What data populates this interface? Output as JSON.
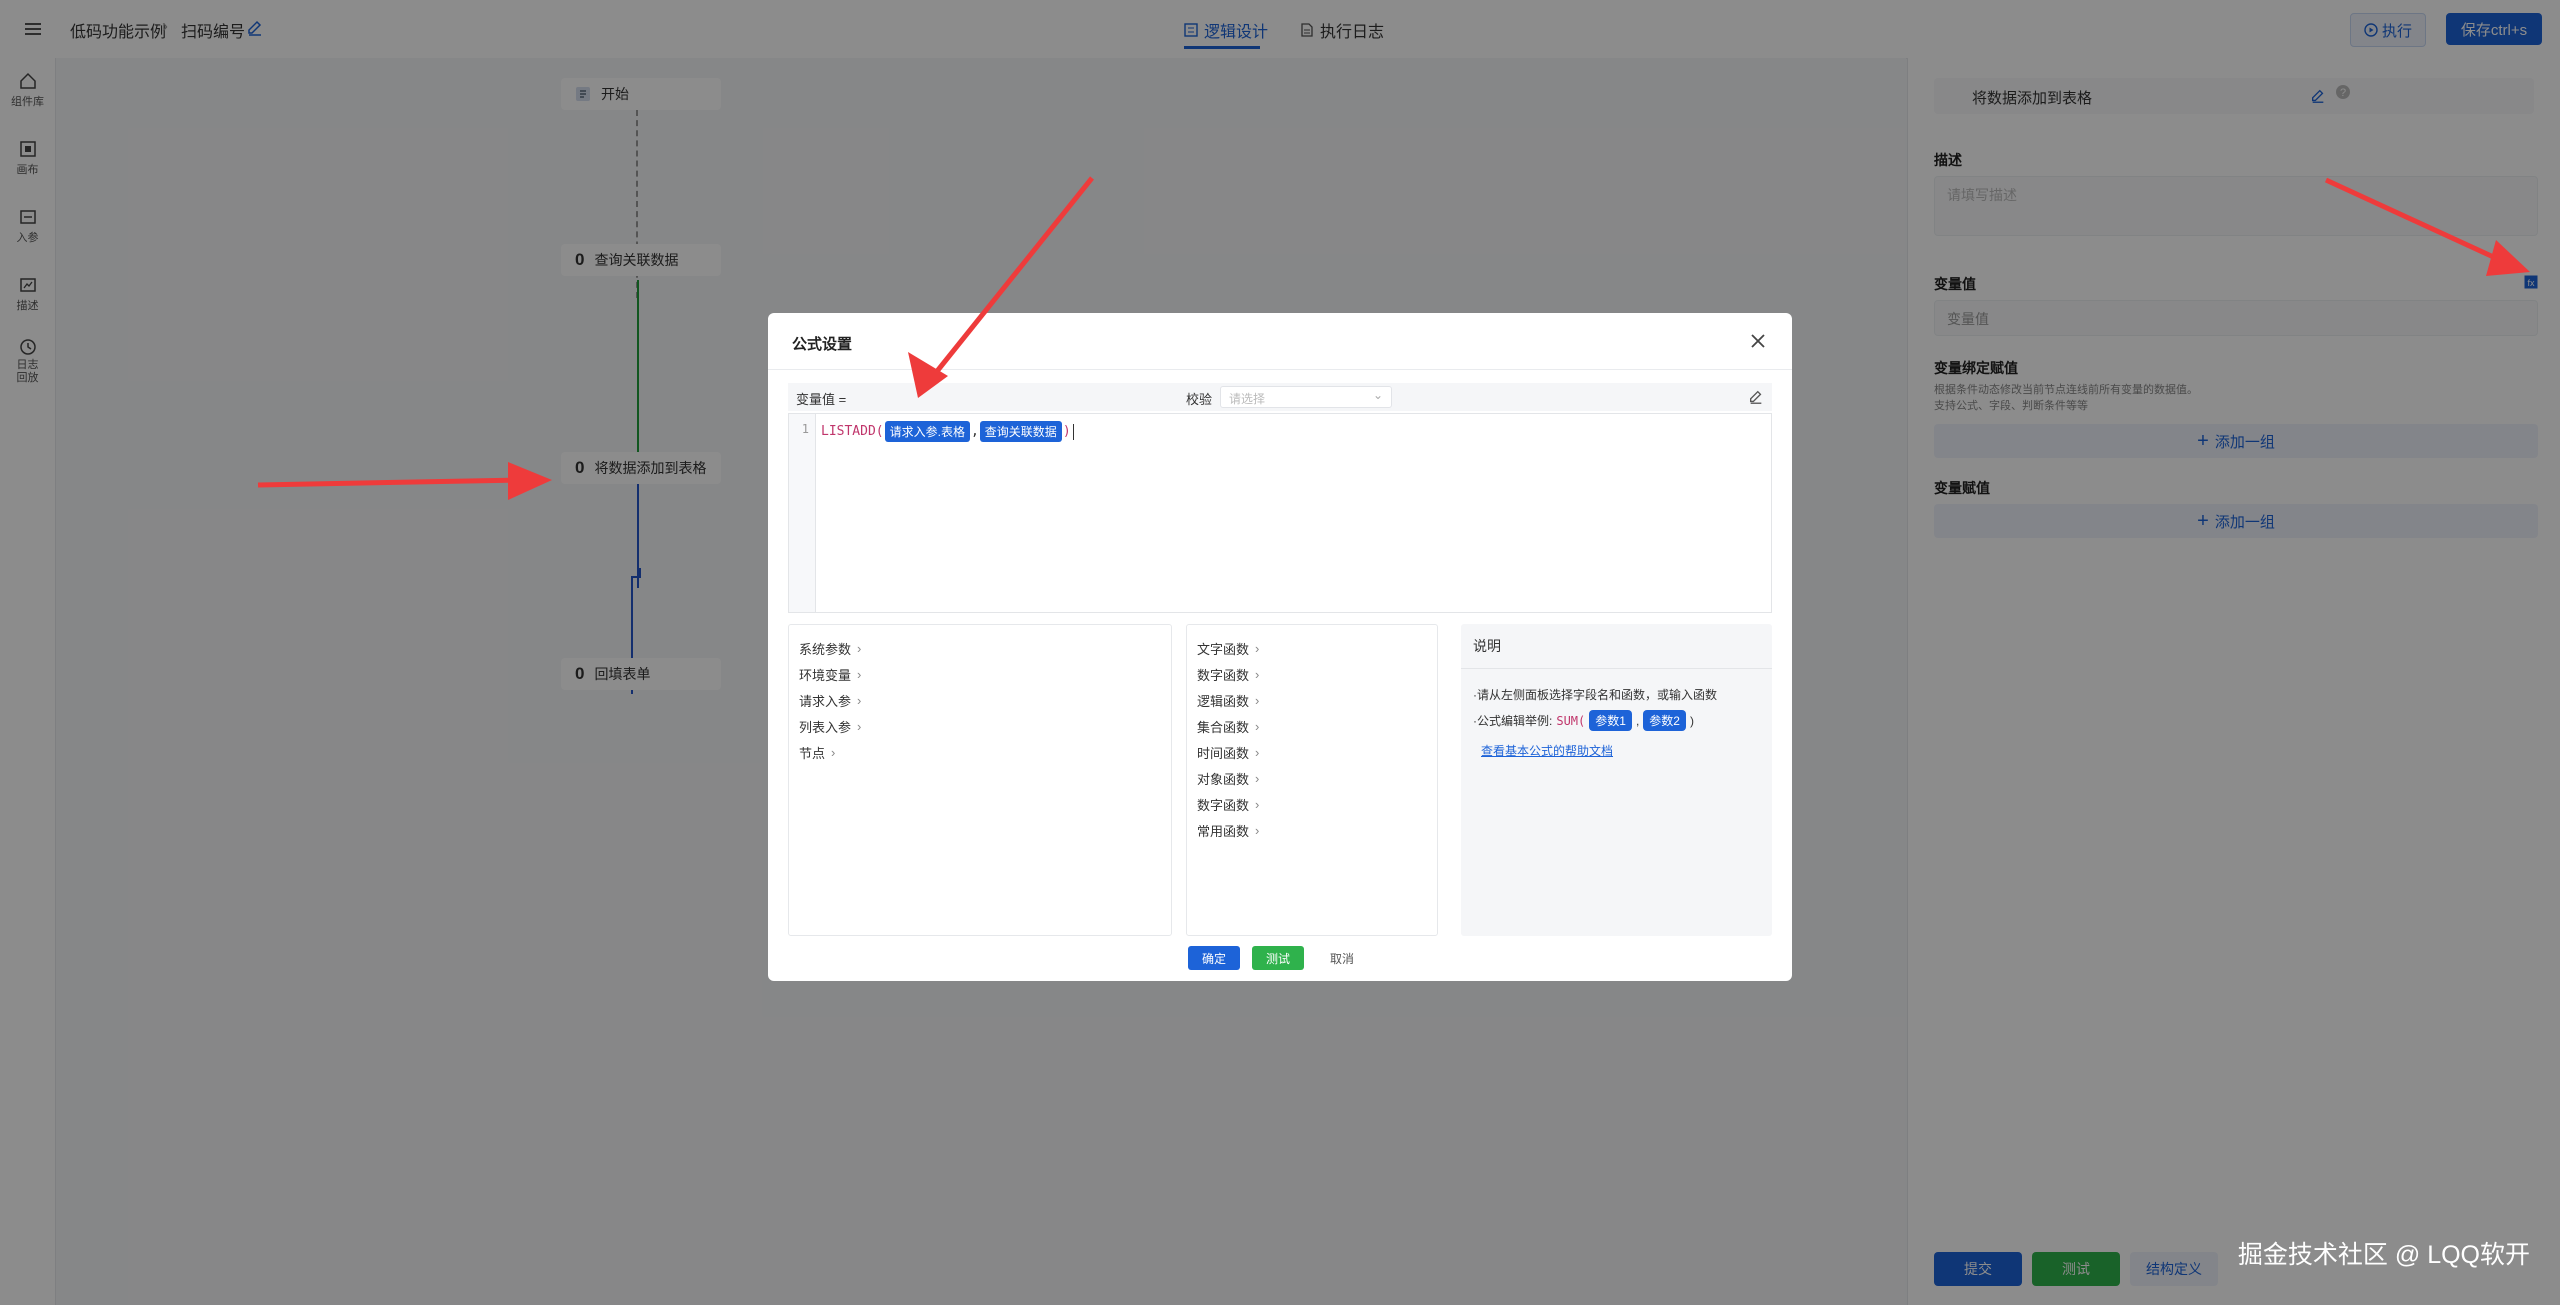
{
  "header": {
    "breadcrumb": [
      "低码功能示例",
      "扫码编号"
    ],
    "tabs": [
      {
        "label": "逻辑设计",
        "active": true
      },
      {
        "label": "执行日志",
        "active": false
      }
    ],
    "execute_label": "执行",
    "save_label": "保存ctrl+s"
  },
  "rail": [
    {
      "label": "组件库",
      "icon": "home-icon"
    },
    {
      "label": "画布",
      "icon": "canvas-icon"
    },
    {
      "label": "入参",
      "icon": "input-icon"
    },
    {
      "label": "描述",
      "icon": "description-icon"
    },
    {
      "label": "日志回放",
      "icon": "log-replay-icon"
    }
  ],
  "flow": {
    "start": "开始",
    "nodes": [
      {
        "count": "0",
        "label": "查询关联数据"
      },
      {
        "count": "0",
        "label": "将数据添加到表格"
      },
      {
        "count": "0",
        "label": "回填表单"
      }
    ]
  },
  "right_panel": {
    "title": "将数据添加到表格",
    "description_label": "描述",
    "description_placeholder": "请填写描述",
    "variable_label": "变量值",
    "variable_placeholder": "变量值",
    "binding_label": "变量绑定赋值",
    "binding_help_1": "根据条件动态修改当前节点连线前所有变量的数据值。",
    "binding_help_2": "支持公式、字段、判断条件等等",
    "add_group_label": "添加一组",
    "assign_label": "变量赋值",
    "submit_label": "提交",
    "test_label": "测试",
    "structure_label": "结构定义"
  },
  "modal": {
    "title": "公式设置",
    "formula_label": "变量值 =",
    "validate_label": "校验",
    "validate_placeholder": "请选择",
    "code": {
      "line_number": "1",
      "fn": "LISTADD(",
      "arg1": "请求入参.表格",
      "comma": ",",
      "arg2": "查询关联数据",
      "close": ")"
    },
    "params": [
      "系统参数",
      "环境变量",
      "请求入参",
      "列表入参",
      "节点"
    ],
    "functions": [
      "文字函数",
      "数字函数",
      "逻辑函数",
      "集合函数",
      "时间函数",
      "对象函数",
      "数字函数",
      "常用函数"
    ],
    "help": {
      "title": "说明",
      "line1": "·请从左侧面板选择字段名和函数，或输入函数",
      "line2_prefix": "·公式编辑举例:",
      "sum": "SUM(",
      "param1": "参数1",
      "comma": ",",
      "param2": "参数2",
      "close": ")",
      "link": "查看基本公式的帮助文档"
    },
    "confirm_label": "确定",
    "test_label": "测试",
    "cancel_label": "取消"
  },
  "watermark": "掘金技术社区 @ LQQ软开",
  "colors": {
    "primary": "#1d63d8",
    "success": "#2fb24c",
    "flow_green": "#1f9d3a",
    "flow_blue": "#2355c9",
    "arrow_red": "#ee3b3b"
  }
}
